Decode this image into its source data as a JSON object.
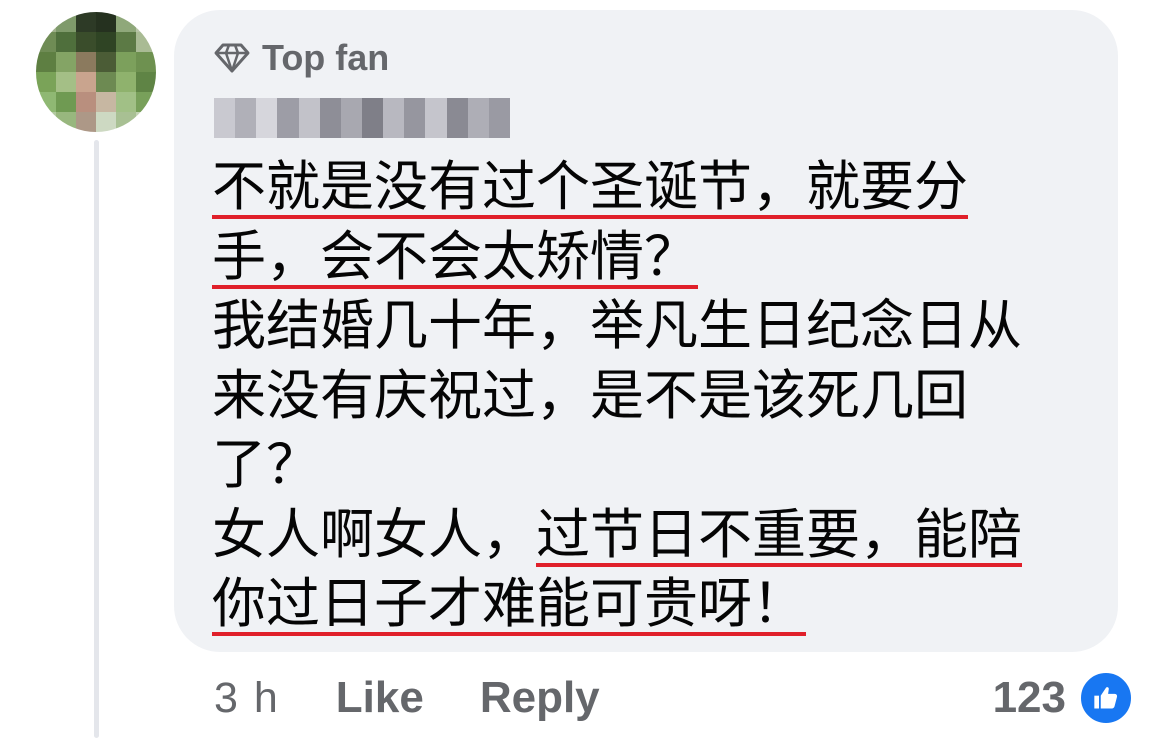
{
  "comment": {
    "badge_label": "Top fan",
    "badge_icon": "diamond-icon",
    "author_name_obscured": true,
    "lines": [
      {
        "parts": [
          {
            "text": "不就是没有过个圣诞节，就要分",
            "underline": true
          }
        ]
      },
      {
        "parts": [
          {
            "text": "手，会不会太矫情？",
            "underline": true
          }
        ]
      },
      {
        "parts": [
          {
            "text": "我结婚几十年，举凡生日纪念日从",
            "underline": false
          }
        ]
      },
      {
        "parts": [
          {
            "text": "来没有庆祝过，是不是该死几回",
            "underline": false
          }
        ]
      },
      {
        "parts": [
          {
            "text": "了？",
            "underline": false
          }
        ]
      },
      {
        "parts": [
          {
            "text": "女人啊女人，",
            "underline": false
          },
          {
            "text": "过节日不重要，能陪",
            "underline": true
          }
        ]
      },
      {
        "parts": [
          {
            "text": "你过日子才难能可贵呀！",
            "underline": true
          }
        ]
      }
    ],
    "underline_color": "#e0202a",
    "bubble_color": "#f0f2f5"
  },
  "actions": {
    "timestamp": "3 h",
    "like_label": "Like",
    "reply_label": "Reply"
  },
  "reactions": {
    "count": "123",
    "icon": "thumbs-up-icon",
    "color": "#1877f2"
  }
}
